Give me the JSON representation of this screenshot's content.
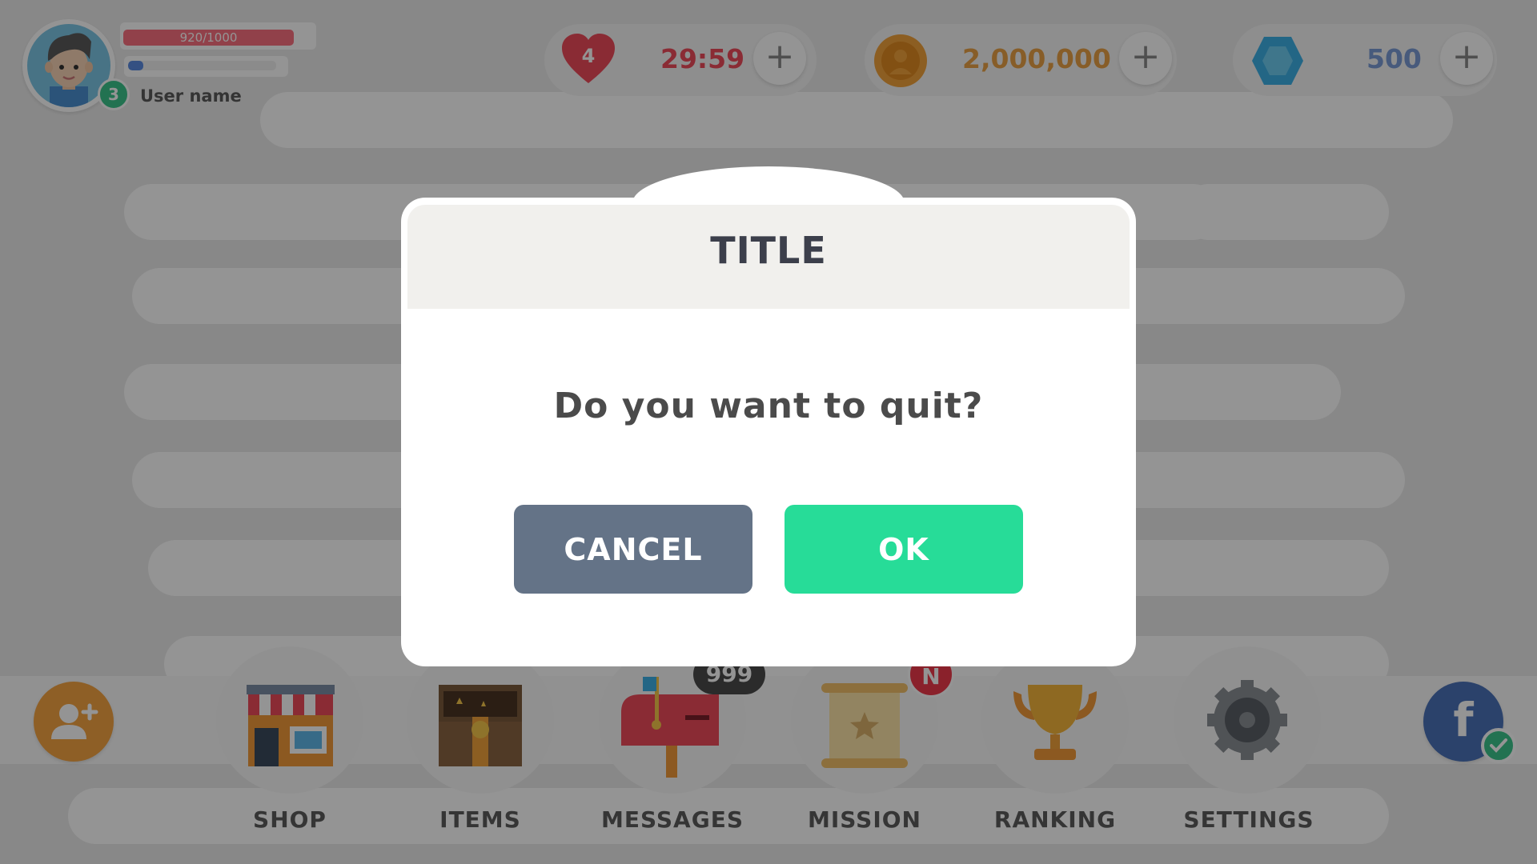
{
  "player": {
    "xp_text": "920/1000",
    "xp_fraction": 0.92,
    "secondary_fraction": 0.1,
    "level": "3",
    "username": "User name"
  },
  "resources": {
    "lives": {
      "count": "4",
      "timer": "29:59",
      "plus": "+",
      "icon": "heart-icon",
      "color": "#ee4b5a"
    },
    "coins": {
      "value": "2,000,000",
      "plus": "+",
      "icon": "coin-icon",
      "color": "#e8a045"
    },
    "gems": {
      "value": "500",
      "plus": "+",
      "icon": "gem-icon",
      "color": "#7a9cd6"
    }
  },
  "menu": {
    "items": [
      {
        "label": "SHOP",
        "icon": "shop-icon"
      },
      {
        "label": "ITEMS",
        "icon": "treasure-chest-icon"
      },
      {
        "label": "MESSAGES",
        "icon": "mailbox-icon"
      },
      {
        "label": "MISSION",
        "icon": "scroll-icon"
      },
      {
        "label": "RANKING",
        "icon": "trophy-icon"
      },
      {
        "label": "SETTINGS",
        "icon": "gear-icon"
      }
    ],
    "messages_badge": "999",
    "mission_badge": "N",
    "facebook_glyph": "f"
  },
  "dialog": {
    "title": "TITLE",
    "message": "Do you want to quit?",
    "cancel_label": "CANCEL",
    "ok_label": "OK"
  },
  "colors": {
    "ok": "#27dc98",
    "cancel": "#647387",
    "overlay": "rgba(0,0,0,0.42)"
  }
}
